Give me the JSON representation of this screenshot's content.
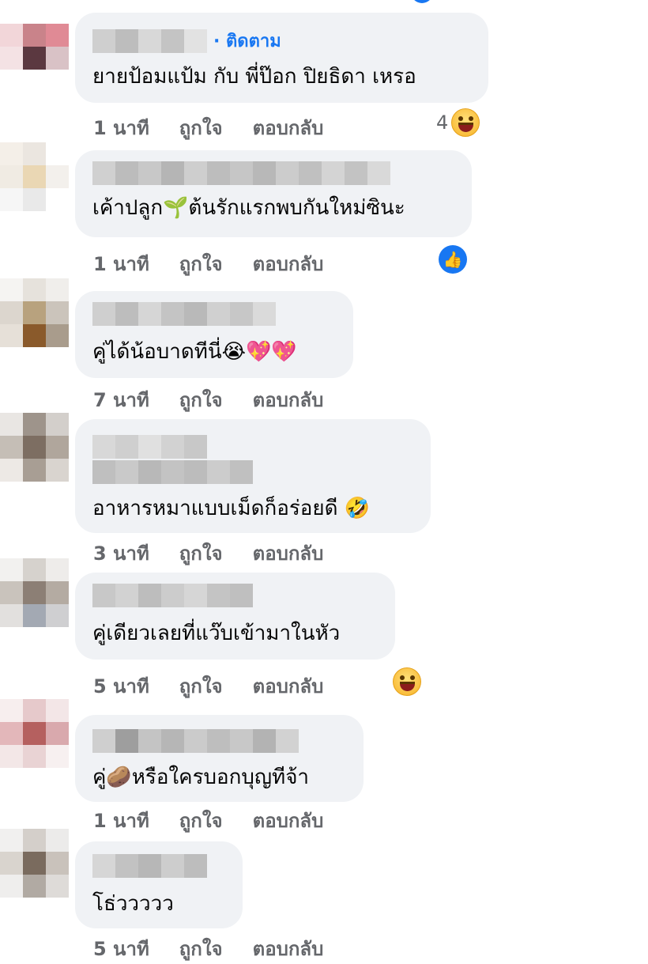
{
  "follow_label": "· ติดตาม",
  "actions": {
    "like": "ถูกใจ",
    "reply": "ตอบกลับ"
  },
  "comments": [
    {
      "text": "ยายป้อมแป้ม กับ พี่ป๊อก ปิยธิดา เหรอ",
      "time": "1 นาที",
      "reaction": "haha-icon",
      "reaction_count": "4"
    },
    {
      "text": "เค้าปลูก🌱ต้นรักแรกพบกันใหม่ซินะ",
      "time": "1 นาที",
      "reaction": "like-icon"
    },
    {
      "text": "คู่ได้น้อบาดทีนี่😭💖💖",
      "time": "7 นาที"
    },
    {
      "text": "อาหารหมาแบบเม็ดก็อร่อยดี 🤣",
      "time": "3 นาที"
    },
    {
      "text": "คู่เดียวเลยที่แว๊บเข้ามาในหัว",
      "time": "5 นาที",
      "reaction": "haha-icon"
    },
    {
      "text": "คู่🥔หรือใครบอกบุญทีจ้า",
      "time": "1 นาที"
    },
    {
      "text": "โธ่ววววว",
      "time": "5 นาที"
    }
  ],
  "colors": {
    "link": "#1877f2",
    "bubble": "#f0f2f5",
    "meta": "#65676b"
  }
}
